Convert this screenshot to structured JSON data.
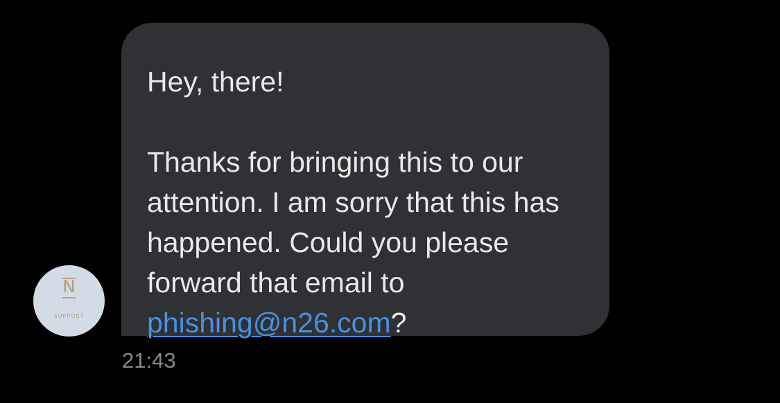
{
  "message": {
    "greeting": "Hey, there!",
    "body": "Thanks for bringing this to our attention. I am sorry that this has happened. Could you please forward that email to",
    "link_text": "phishing@n26.com",
    "trailing": "?",
    "timestamp": "21:43"
  },
  "sender": {
    "avatar_letter": "N",
    "avatar_caption": "SUPPORT"
  },
  "colors": {
    "background": "#000000",
    "bubble": "#2f3134",
    "text": "#e9e9ea",
    "link": "#4a90e2",
    "timestamp": "#8a8a8e",
    "avatar_bg": "#d3dbe6",
    "logo_gold": "#b5a17c"
  }
}
